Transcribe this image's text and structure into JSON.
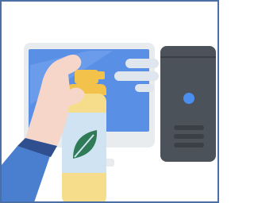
{
  "image": {
    "subject": "illustration-cleaning-computer",
    "icons": [
      "monitor-icon",
      "computer-tower-icon",
      "spray-bottle-icon",
      "leaf-icon",
      "hand-icon",
      "spray-mist-icon"
    ]
  },
  "colors": {
    "frame_border": "#4a6fa5",
    "monitor_frame": "#e8ecef",
    "monitor_screen": "#5a8fe6",
    "screen_glare": "#7aa8ef",
    "tower_body": "#4b5259",
    "tower_accent": "#3a4046",
    "tower_button": "#4a8ff0",
    "bottle_body": "#f6dd8c",
    "bottle_band": "#cfe3f3",
    "bottle_neck": "#f3c24a",
    "leaf": "#2f7b57",
    "mist": "#dfe6ee",
    "skin": "#f5d6c8",
    "sleeve": "#4a7fcf",
    "cuff": "#2f4f8f"
  }
}
